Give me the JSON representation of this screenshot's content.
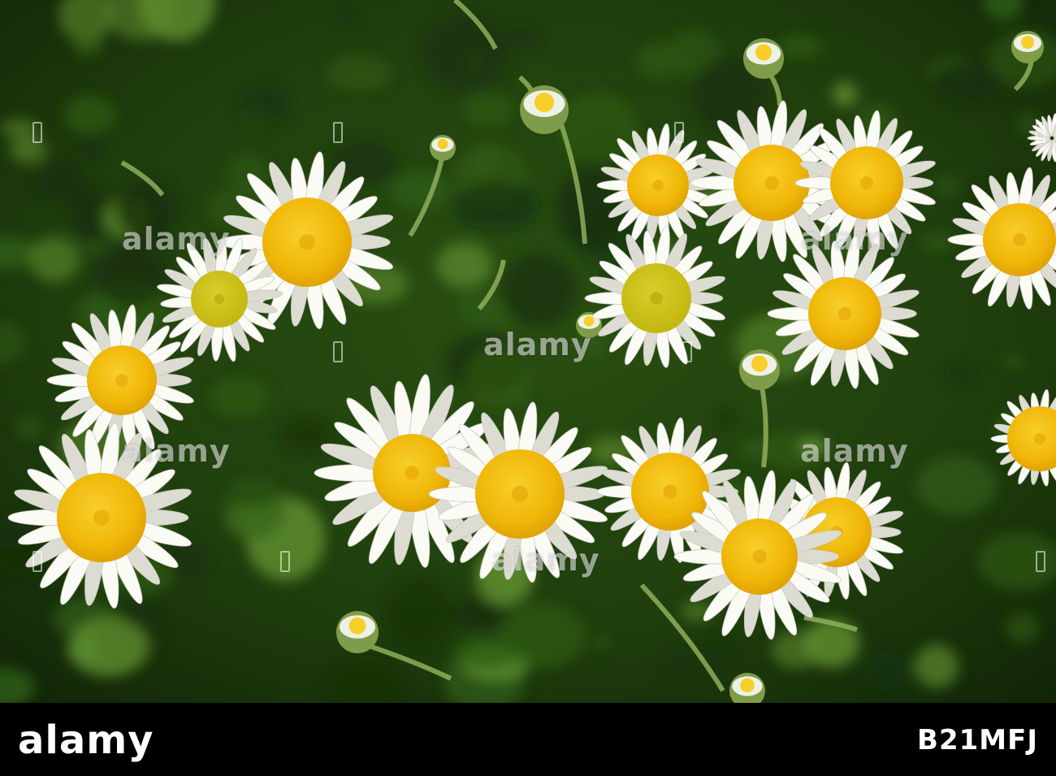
{
  "image": {
    "subject": "chamomile-flowers",
    "colors": {
      "foliage_dark": "#17300b",
      "foliage_mid": "#2f5a15",
      "foliage_light": "#5e8c2e",
      "petal": "#fbfbf6",
      "petal_shadow": "#dcdcd2",
      "disk": "#f2b807",
      "disk_light": "#f7cf2a",
      "disk_green": "#c8c415",
      "stem": "#8fae5a"
    }
  },
  "watermark": {
    "text": "alamy"
  },
  "footer": {
    "brand": "alamy",
    "stock_id": "B21MFJ",
    "background": "#000000",
    "text_color": "#ffffff"
  }
}
